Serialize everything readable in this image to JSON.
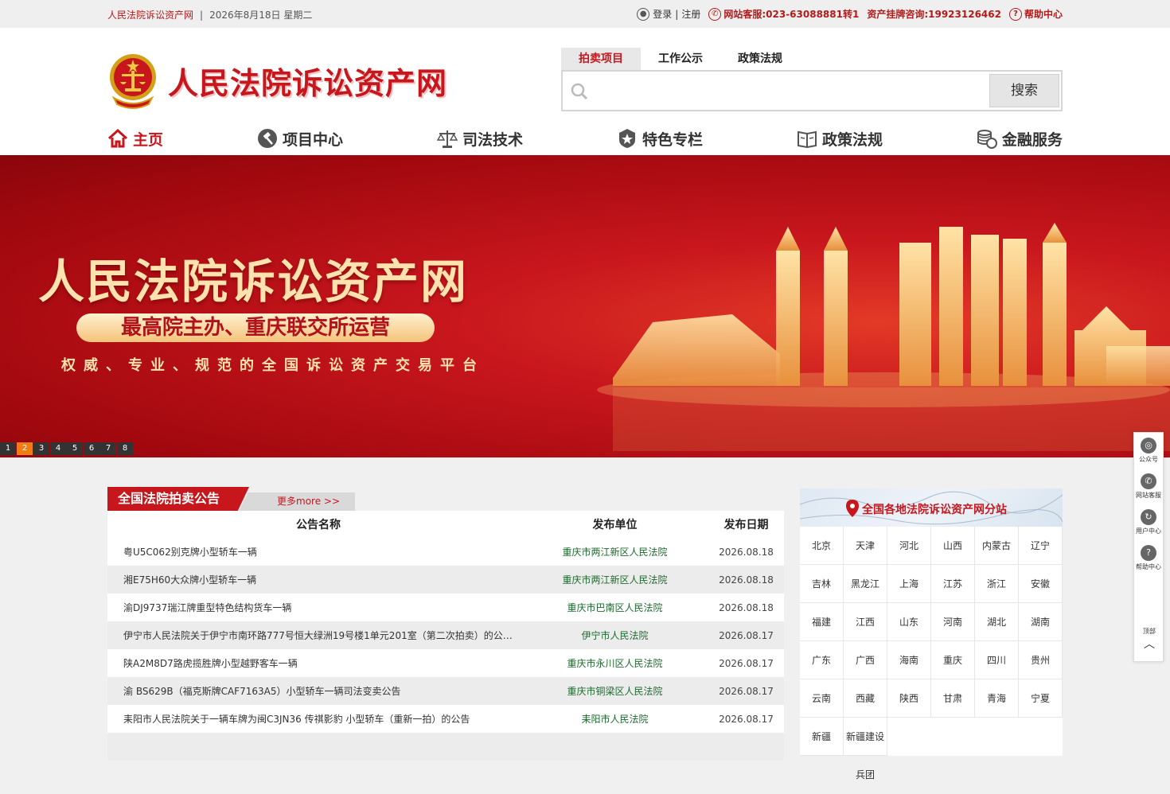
{
  "topbar": {
    "site_name": "人民法院诉讼资产网",
    "separator": "|",
    "date": "2026年8月18日  星期二",
    "login": "登录",
    "register": "注册",
    "hotline": "网站客服:023-63088881转1",
    "consult": "资产挂牌咨询:19923126462",
    "help": "帮助中心"
  },
  "header": {
    "logo_text": "人民法院诉讼资产网",
    "search_tabs": [
      "拍卖项目",
      "工作公示",
      "政策法规"
    ],
    "search_button": "搜索",
    "search_placeholder": ""
  },
  "nav": [
    "主页",
    "项目中心",
    "司法技术",
    "特色专栏",
    "政策法规",
    "金融服务"
  ],
  "banner": {
    "title": "人民法院诉讼资产网",
    "pill": "最高院主办、重庆联交所运营",
    "subtitle": "权威、专业、规范的全国诉讼资产交易平台",
    "pages": [
      "1",
      "2",
      "3",
      "4",
      "5",
      "6",
      "7",
      "8"
    ],
    "current_page": "2",
    "colors": {
      "red": "#c8161d",
      "gold": "#ffe2ad"
    }
  },
  "notice": {
    "title": "全国法院拍卖公告",
    "more": "更多more >>",
    "columns": [
      "公告名称",
      "发布单位",
      "发布日期"
    ],
    "rows": [
      {
        "name": "粤U5C062别克牌小型轿车一辆",
        "unit": "重庆市两江新区人民法院",
        "date": "2026.08.18"
      },
      {
        "name": "湘E75H60大众牌小型轿车一辆",
        "unit": "重庆市两江新区人民法院",
        "date": "2026.08.18"
      },
      {
        "name": "渝DJ9737瑞江牌重型特色结构货车一辆",
        "unit": "重庆市巴南区人民法院",
        "date": "2026.08.18"
      },
      {
        "name": "伊宁市人民法院关于伊宁市南环路777号恒大绿洲19号楼1单元201室（第二次拍卖）的公…",
        "unit": "伊宁市人民法院",
        "date": "2026.08.17"
      },
      {
        "name": "陕A2M8D7路虎揽胜牌小型越野客车一辆",
        "unit": "重庆市永川区人民法院",
        "date": "2026.08.17"
      },
      {
        "name": "渝 BS629B（福克斯牌CAF7163A5）小型轿车一辆司法变卖公告",
        "unit": "重庆市铜梁区人民法院",
        "date": "2026.08.17"
      },
      {
        "name": "耒阳市人民法院关于一辆车牌为闽C3JN36 传祺影豹 小型轿车（重新一拍）的公告",
        "unit": "耒阳市人民法院",
        "date": "2026.08.17"
      }
    ]
  },
  "branch": {
    "title": "全国各地法院诉讼资产网分站",
    "regions": [
      "北京",
      "天津",
      "河北",
      "山西",
      "内蒙古",
      "辽宁",
      "吉林",
      "黑龙江",
      "上海",
      "江苏",
      "浙江",
      "安徽",
      "福建",
      "江西",
      "山东",
      "河南",
      "湖北",
      "湖南",
      "广东",
      "广西",
      "海南",
      "重庆",
      "四川",
      "贵州",
      "云南",
      "西藏",
      "陕西",
      "甘肃",
      "青海",
      "宁夏",
      "新疆",
      "新疆建设兵团"
    ]
  },
  "float_bar": {
    "items": [
      "公众号",
      "网站客服",
      "用户中心",
      "帮助中心"
    ],
    "top": "顶部"
  }
}
